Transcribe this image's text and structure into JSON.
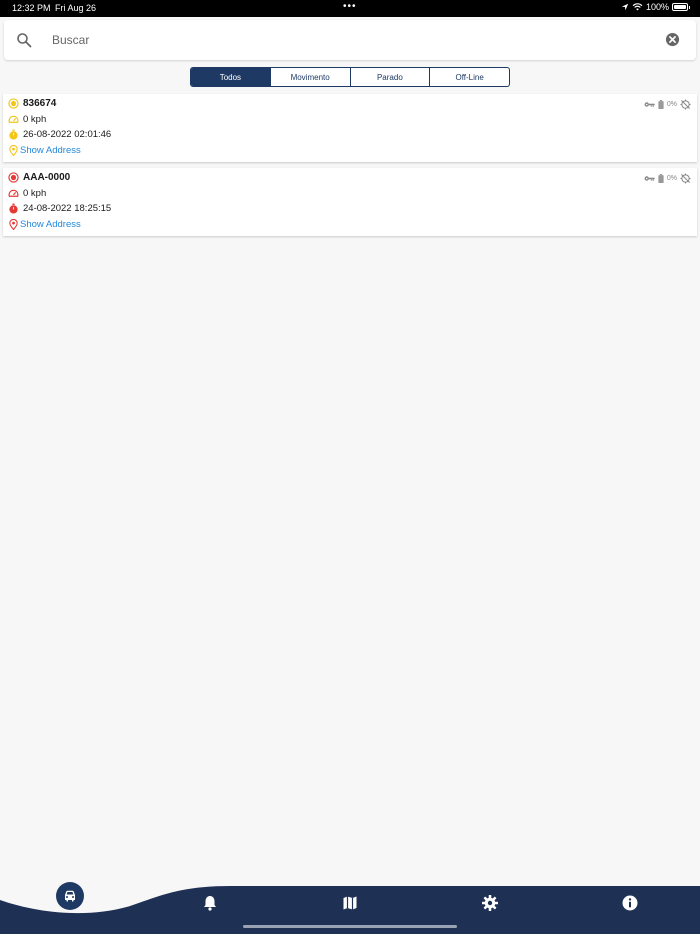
{
  "status_bar": {
    "time": "12:32 PM",
    "date": "Fri Aug 26",
    "battery": "100%",
    "battery_level": 1.0
  },
  "search": {
    "placeholder": "Buscar",
    "value": ""
  },
  "filter_tabs": [
    {
      "label": "Todos",
      "active": true
    },
    {
      "label": "Movimento",
      "active": false
    },
    {
      "label": "Parado",
      "active": false
    },
    {
      "label": "Off-Line",
      "active": false
    }
  ],
  "vehicles": [
    {
      "name": "836674",
      "speed": "0 kph",
      "timestamp": "26-08-2022 02:01:46",
      "address_link": "Show Address",
      "battery": "0%",
      "status_color": "#f5c518"
    },
    {
      "name": "AAA-0000",
      "speed": "0 kph",
      "timestamp": "24-08-2022 18:25:15",
      "address_link": "Show Address",
      "battery": "0%",
      "status_color": "#e53935"
    }
  ],
  "bottom_nav": {
    "items": [
      {
        "icon": "car-icon",
        "active": true
      },
      {
        "icon": "bell-icon",
        "active": false
      },
      {
        "icon": "map-icon",
        "active": false
      },
      {
        "icon": "gear-icon",
        "active": false
      },
      {
        "icon": "info-icon",
        "active": false
      }
    ],
    "color": "#1e3054"
  }
}
